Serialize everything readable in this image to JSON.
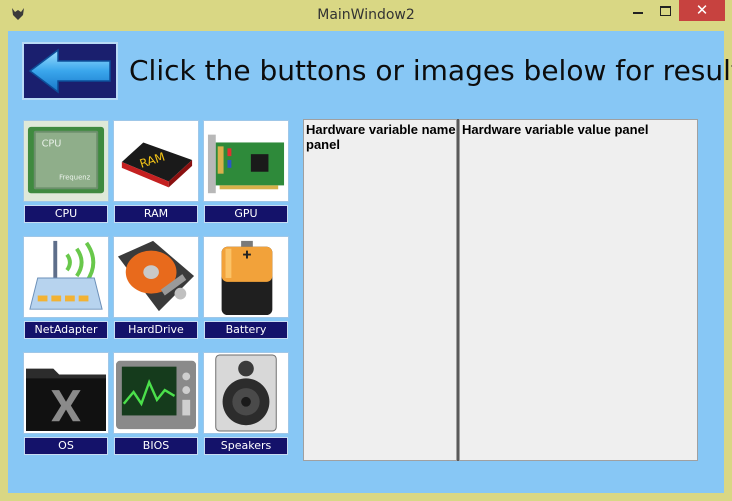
{
  "window": {
    "title": "MainWindow2",
    "close_glyph": "✕"
  },
  "header": {
    "instruction": "Click the buttons or images below for result",
    "back_icon": "left-arrow-icon"
  },
  "tiles": [
    {
      "label": "CPU",
      "icon": "cpu-icon"
    },
    {
      "label": "RAM",
      "icon": "ram-icon"
    },
    {
      "label": "GPU",
      "icon": "gpu-icon"
    },
    {
      "label": "NetAdapter",
      "icon": "router-icon"
    },
    {
      "label": "HardDrive",
      "icon": "harddrive-icon"
    },
    {
      "label": "Battery",
      "icon": "battery-icon"
    },
    {
      "label": "OS",
      "icon": "os-folder-icon"
    },
    {
      "label": "BIOS",
      "icon": "bios-monitor-icon"
    },
    {
      "label": "Speakers",
      "icon": "speaker-icon"
    }
  ],
  "icon_text": {
    "cpu": "CPU",
    "cpu_sub": "Frequenz",
    "ram": "RAM"
  },
  "panels": {
    "name_title": "Hardware variable name panel",
    "value_title": "Hardware variable value panel"
  },
  "colors": {
    "background": "#87c7f5",
    "tile_label_bg": "#14126a",
    "close_button": "#c7423f"
  }
}
